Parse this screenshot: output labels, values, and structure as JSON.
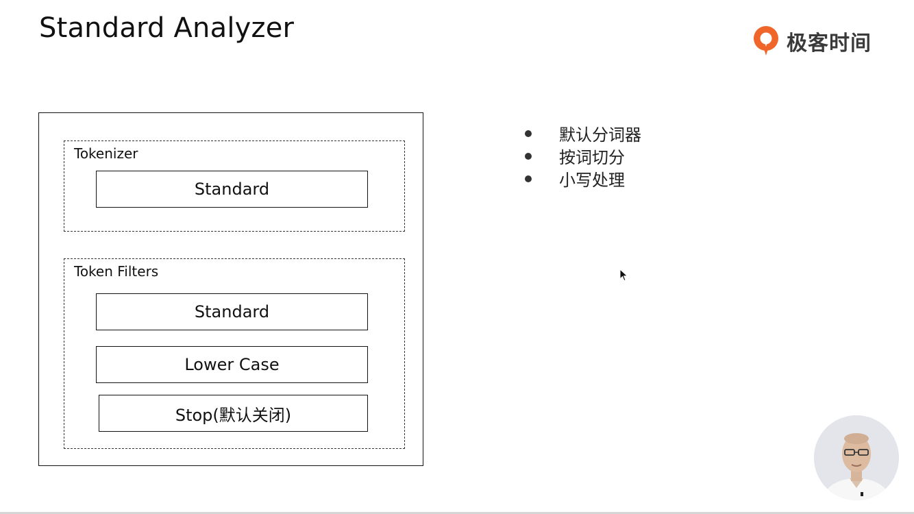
{
  "slide": {
    "title": "Standard Analyzer"
  },
  "brand": {
    "name": "极客时间",
    "icon": "geektime-logo-icon",
    "accent_color": "#f0652a"
  },
  "diagram": {
    "tokenizer": {
      "label": "Tokenizer",
      "stages": [
        "Standard"
      ]
    },
    "token_filters": {
      "label": "Token Filters",
      "stages": [
        "Standard",
        "Lower Case",
        "Stop(默认关闭)"
      ]
    }
  },
  "notes": {
    "bullets": [
      "默认分词器",
      "按词切分",
      "小写处理"
    ]
  },
  "icons": {
    "cursor": "mouse-pointer-icon",
    "presenter": "presenter-video-icon"
  }
}
